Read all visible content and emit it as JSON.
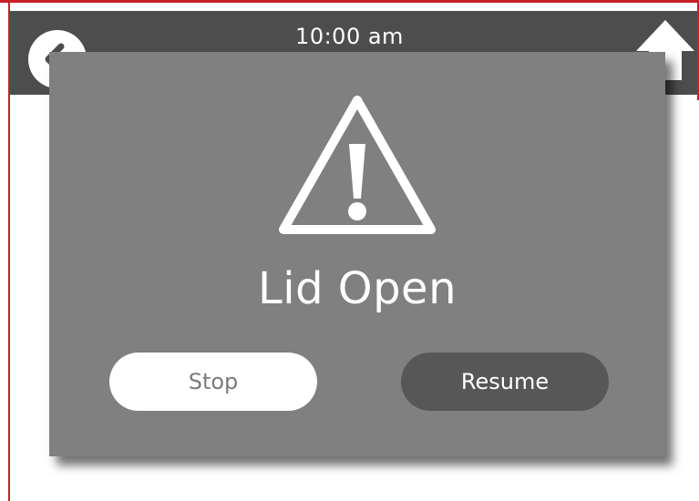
{
  "header": {
    "time": "10:00 am",
    "back_icon": "back-arrow-icon",
    "home_icon": "home-icon"
  },
  "dialog": {
    "icon": "warning-icon",
    "title": "Lid Open",
    "stop_label": "Stop",
    "resume_label": "Resume"
  },
  "colors": {
    "frame": "#c8202a",
    "header_bg": "#4d4d4d",
    "dialog_bg": "#808080",
    "resume_bg": "#575757",
    "stop_bg": "#ffffff"
  }
}
